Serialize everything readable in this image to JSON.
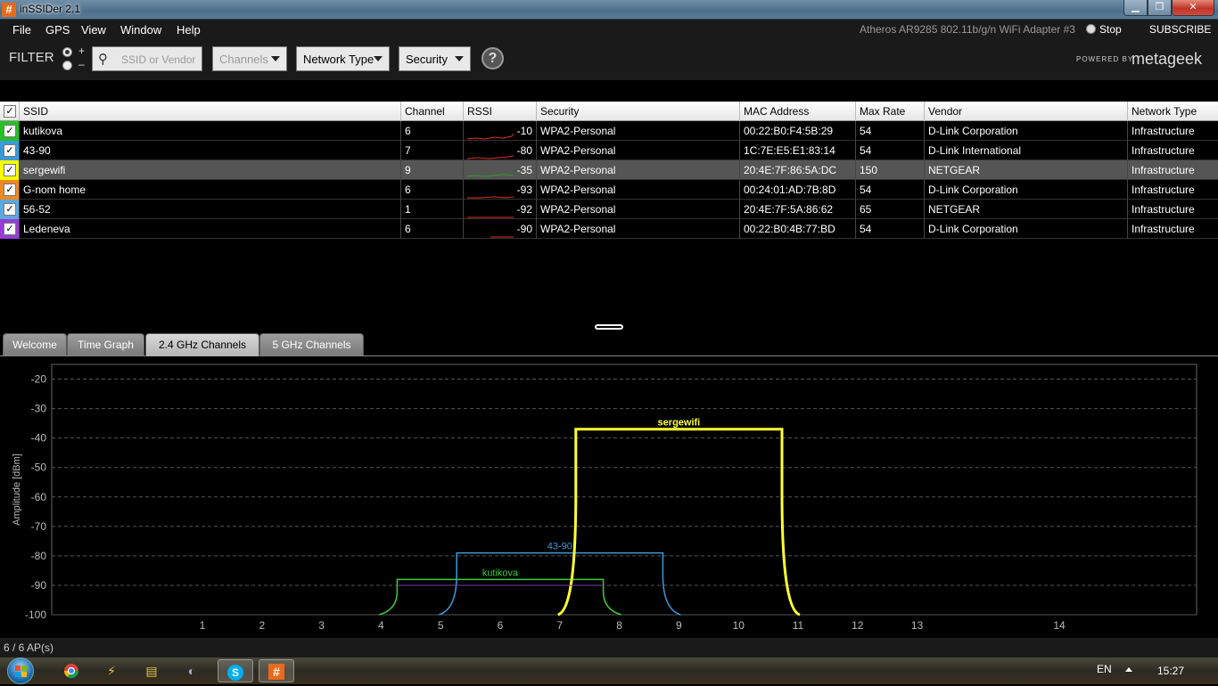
{
  "window": {
    "title": "inSSIDer 2.1",
    "icon": "#"
  },
  "menu": {
    "items": [
      "File",
      "GPS",
      "View",
      "Window",
      "Help"
    ],
    "adapter": "Atheros AR9285 802.11b/g/n WiFi Adapter #3",
    "stop_label": "Stop",
    "subscribe_label": "SUBSCRIBE"
  },
  "filter": {
    "label": "FILTER",
    "plus": "+",
    "minus": "–",
    "search_placeholder": "SSID or Vendor",
    "channels_label": "Channels",
    "network_type_label": "Network Type",
    "security_label": "Security",
    "help_label": "?",
    "powered_by": "POWERED BY",
    "brand": "metageek"
  },
  "grid": {
    "columns": [
      "SSID",
      "Channel",
      "RSSI",
      "Security",
      "MAC Address",
      "Max Rate",
      "Vendor",
      "Network Type"
    ],
    "rows": [
      {
        "color": "#22c222",
        "ssid": "kutikova",
        "channel": "6",
        "rssi": "-10",
        "security": "WPA2-Personal",
        "mac": "00:22:B0:F4:5B:29",
        "rate": "54",
        "vendor": "D-Link Corporation",
        "type": "Infrastructure"
      },
      {
        "color": "#3a9ad9",
        "ssid": "43-90",
        "channel": "7",
        "rssi": "-80",
        "security": "WPA2-Personal",
        "mac": "1C:7E:E5:E1:83:14",
        "rate": "54",
        "vendor": "D-Link International",
        "type": "Infrastructure"
      },
      {
        "color": "#ffff00",
        "ssid": "sergewifi",
        "channel": "9",
        "rssi": "-35",
        "security": "WPA2-Personal",
        "mac": "20:4E:7F:86:5A:DC",
        "rate": "150",
        "vendor": "NETGEAR",
        "type": "Infrastructure"
      },
      {
        "color": "#ee8a22",
        "ssid": "G-nom home",
        "channel": "6",
        "rssi": "-93",
        "security": "WPA2-Personal",
        "mac": "00:24:01:AD:7B:8D",
        "rate": "54",
        "vendor": "D-Link Corporation",
        "type": "Infrastructure"
      },
      {
        "color": "#5aa8e0",
        "ssid": "56-52",
        "channel": "1",
        "rssi": "-92",
        "security": "WPA2-Personal",
        "mac": "20:4E:7F:5A:86:62",
        "rate": "65",
        "vendor": "NETGEAR",
        "type": "Infrastructure"
      },
      {
        "color": "#9a3ad9",
        "ssid": "Ledeneva",
        "channel": "6",
        "rssi": "-90",
        "security": "WPA2-Personal",
        "mac": "00:22:B0:4B:77:BD",
        "rate": "54",
        "vendor": "D-Link Corporation",
        "type": "Infrastructure"
      }
    ],
    "selected_index": 2
  },
  "tabs": [
    "Welcome",
    "Time Graph",
    "2.4 GHz Channels",
    "5 GHz Channels"
  ],
  "active_tab": 2,
  "chart_data": {
    "type": "line",
    "ylabel": "Amplitude [dBm]",
    "ylim": [
      -100,
      -15
    ],
    "yticks": [
      -20,
      -30,
      -40,
      -50,
      -60,
      -70,
      -80,
      -90,
      -100
    ],
    "xticks": [
      1,
      2,
      3,
      4,
      5,
      6,
      7,
      8,
      9,
      10,
      11,
      12,
      13,
      14
    ],
    "grid": true,
    "series": [
      {
        "name": "kutikova",
        "color": "#3ccc3c",
        "channel": 6,
        "rssi": -88,
        "width": 1.5
      },
      {
        "name": "43-90",
        "color": "#3a9ad9",
        "channel": 7,
        "rssi": -79,
        "width": 1.5
      },
      {
        "name": "sergewifi",
        "color": "#ffff33",
        "channel": 9,
        "rssi": -37,
        "width": 3
      },
      {
        "name": "",
        "color": "#7a3aa9",
        "channel": 6,
        "rssi": -90,
        "width": 1
      }
    ]
  },
  "status": {
    "text": "6 / 6 AP(s)"
  },
  "taskbar": {
    "lang": "EN",
    "clock": "15:27"
  }
}
